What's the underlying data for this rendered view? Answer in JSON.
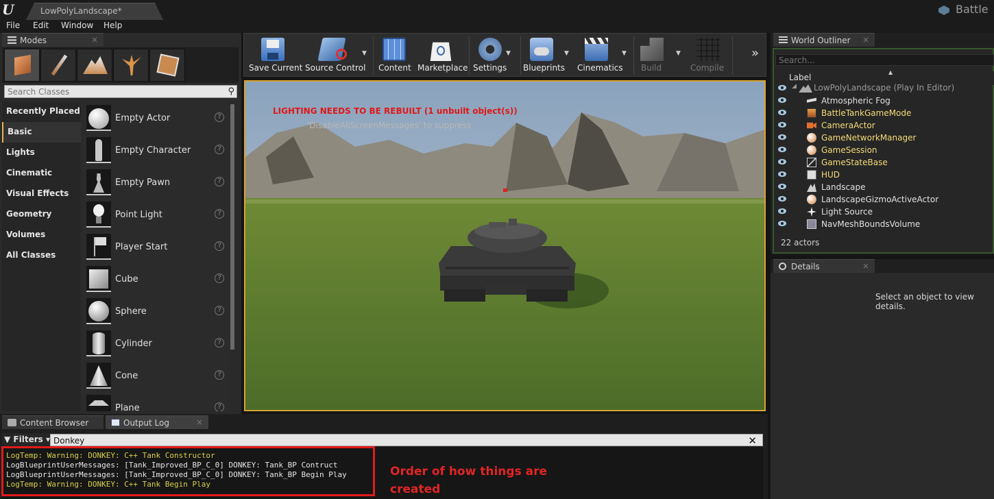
{
  "window": {
    "doc_tab": "LowPolyLandscape*",
    "project_name": "Battle"
  },
  "menu": [
    "File",
    "Edit",
    "Window",
    "Help"
  ],
  "modes": {
    "tab_title": "Modes",
    "search_placeholder": "Search Classes",
    "categories": [
      "Recently Placed",
      "Basic",
      "Lights",
      "Cinematic",
      "Visual Effects",
      "Geometry",
      "Volumes",
      "All Classes"
    ],
    "active_category": "Basic",
    "classes": [
      "Empty Actor",
      "Empty Character",
      "Empty Pawn",
      "Point Light",
      "Player Start",
      "Cube",
      "Sphere",
      "Cylinder",
      "Cone",
      "Plane"
    ]
  },
  "toolbar": [
    {
      "label": "Save Current",
      "icon": "save-icon",
      "dropdown": false,
      "enabled": true
    },
    {
      "label": "Source Control",
      "icon": "source-control-icon",
      "dropdown": true,
      "enabled": true
    },
    {
      "label": "Content",
      "icon": "content-icon",
      "dropdown": false,
      "enabled": true
    },
    {
      "label": "Marketplace",
      "icon": "marketplace-icon",
      "dropdown": false,
      "enabled": true
    },
    {
      "label": "Settings",
      "icon": "settings-icon",
      "dropdown": true,
      "enabled": true
    },
    {
      "label": "Blueprints",
      "icon": "blueprints-icon",
      "dropdown": true,
      "enabled": true
    },
    {
      "label": "Cinematics",
      "icon": "cinematics-icon",
      "dropdown": true,
      "enabled": true
    },
    {
      "label": "Build",
      "icon": "build-icon",
      "dropdown": true,
      "enabled": false
    },
    {
      "label": "Compile",
      "icon": "compile-icon",
      "dropdown": false,
      "enabled": false
    }
  ],
  "viewport": {
    "warning": "LIGHTING NEEDS TO BE REBUILT (1 unbuilt object(s))",
    "suppress_hint": "'DisableAllScreenMessages' to suppress"
  },
  "outliner": {
    "tab_title": "World Outliner",
    "search_placeholder": "Search...",
    "column_label": "Label",
    "root": "LowPolyLandscape (Play In Editor)",
    "items": [
      {
        "name": "Atmospheric Fog",
        "highlight": false,
        "icon": "fog-icon"
      },
      {
        "name": "BattleTankGameMode",
        "highlight": true,
        "icon": "blueprint-icon"
      },
      {
        "name": "CameraActor",
        "highlight": true,
        "icon": "camera-icon"
      },
      {
        "name": "GameNetworkManager",
        "highlight": true,
        "icon": "actor-icon"
      },
      {
        "name": "GameSession",
        "highlight": true,
        "icon": "actor-icon"
      },
      {
        "name": "GameStateBase",
        "highlight": true,
        "icon": "graph-icon"
      },
      {
        "name": "HUD",
        "highlight": true,
        "icon": "hud-icon"
      },
      {
        "name": "Landscape",
        "highlight": false,
        "icon": "landscape-icon"
      },
      {
        "name": "LandscapeGizmoActiveActor",
        "highlight": false,
        "icon": "actor-icon"
      },
      {
        "name": "Light Source",
        "highlight": false,
        "icon": "light-icon"
      },
      {
        "name": "NavMeshBoundsVolume",
        "highlight": false,
        "icon": "volume-icon"
      }
    ],
    "actor_count": "22 actors"
  },
  "details": {
    "tab_title": "Details",
    "empty_message": "Select an object to view details."
  },
  "bottom_tabs": [
    "Content Browser",
    "Output Log"
  ],
  "output_log": {
    "filters_label": "Filters",
    "filter_value": "Donkey",
    "lines": [
      {
        "text": "LogTemp: Warning: DONKEY: C++ Tank Constructor",
        "level": "warning"
      },
      {
        "text": "LogBlueprintUserMessages: [Tank_Improved_BP_C_0] DONKEY: Tank_BP Contruct",
        "level": "info"
      },
      {
        "text": "LogBlueprintUserMessages: [Tank_Improved_BP_C_0] DONKEY: Tank_BP Begin Play",
        "level": "info"
      },
      {
        "text": "LogTemp: Warning: DONKEY: C++ Tank Begin Play",
        "level": "warning"
      }
    ]
  },
  "annotation": "Order of how things are created",
  "colors": {
    "warning_log": "#d8d04a",
    "info_log": "#e6e6e6",
    "highlight_actor": "#f4dc78",
    "annotation": "#e12525",
    "viewport_border": "#d9a530"
  }
}
